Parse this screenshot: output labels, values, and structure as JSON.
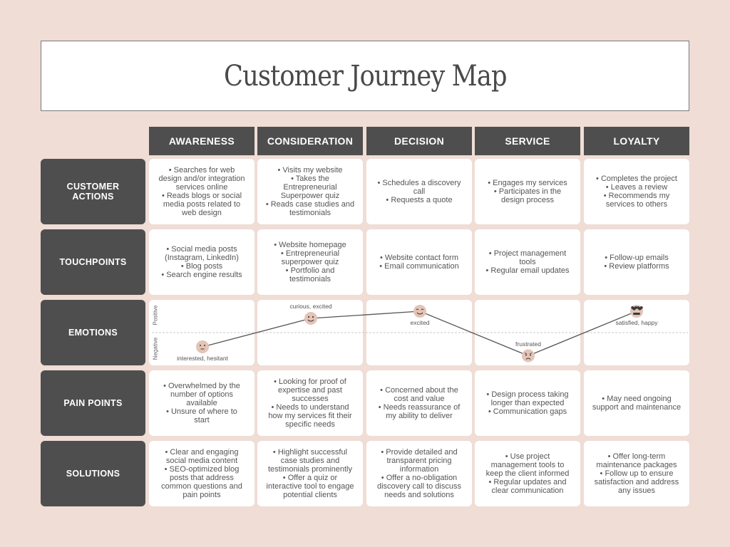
{
  "title": "Customer Journey Map",
  "stages": [
    "AWARENESS",
    "CONSIDERATION",
    "DECISION",
    "SERVICE",
    "LOYALTY"
  ],
  "rows": {
    "customer_actions": {
      "label": "CUSTOMER\nACTIONS",
      "cells": [
        "• Searches for web\ndesign and/or integration\nservices online\n• Reads blogs or social\nmedia posts related to\nweb design",
        "• Visits my website\n• Takes the\nEntrepreneurial\nSuperpower quiz\n• Reads case studies and\ntestimonials",
        "• Schedules a discovery\ncall\n• Requests a quote",
        "• Engages my services\n• Participates in the\ndesign process",
        "• Completes the project\n• Leaves a review\n• Recommends my\nservices to others"
      ]
    },
    "touchpoints": {
      "label": "TOUCHPOINTS",
      "cells": [
        "• Social media posts\n(Instagram, LinkedIn)\n• Blog posts\n• Search engine results",
        "• Website homepage\n• Entrepreneurial\nsuperpower quiz\n• Portfolio and\ntestimonials",
        "• Website contact form\n• Email communication",
        "• Project management\ntools\n• Regular email updates",
        "• Follow-up emails\n• Review platforms"
      ]
    },
    "emotions": {
      "label": "EMOTIONS",
      "axis_positive": "Positive",
      "axis_negative": "Negative",
      "points": [
        {
          "stage": "AWARENESS",
          "label": "interested, hesitant",
          "face": "hesitant-face-icon",
          "level": -0.4
        },
        {
          "stage": "CONSIDERATION",
          "label": "curious, excited",
          "face": "curious-face-icon",
          "level": 0.4
        },
        {
          "stage": "DECISION",
          "label": "excited",
          "face": "happy-face-icon",
          "level": 0.6
        },
        {
          "stage": "SERVICE",
          "label": "frustrated",
          "face": "frustrated-face-icon",
          "level": -0.65
        },
        {
          "stage": "LOYALTY",
          "label": "satisfied, happy",
          "face": "heart-eyes-face-icon",
          "level": 0.6
        }
      ]
    },
    "pain_points": {
      "label": "PAIN POINTS",
      "cells": [
        "• Overwhelmed by the\nnumber of options\navailable\n• Unsure of where to\nstart",
        "• Looking for proof of\nexpertise and past\nsuccesses\n• Needs to understand\nhow my services fit their\nspecific needs",
        "• Concerned about the\ncost and value\n• Needs reassurance of\nmy ability to deliver",
        "• Design process taking\nlonger than expected\n• Communication gaps",
        "• May need ongoing\nsupport and maintenance"
      ]
    },
    "solutions": {
      "label": "SOLUTIONS",
      "cells": [
        "• Clear and engaging\nsocial media content\n• SEO-optimized blog\nposts that address\ncommon questions and\npain points",
        "• Highlight successful\ncase studies and\ntestimonials prominently\n• Offer a quiz or\ninteractive tool to engage\npotential clients",
        "• Provide detailed and\ntransparent pricing\ninformation\n• Offer a no-obligation\ndiscovery call to discuss\nneeds and solutions",
        "• Use project\nmanagement tools to\nkeep the client informed\n• Regular updates and\nclear communication",
        "• Offer long-term\nmaintenance packages\n• Follow up to ensure\nsatisfaction and address\nany issues"
      ]
    }
  },
  "colors": {
    "background": "#efddd6",
    "header_dark": "#4e4e4e",
    "cell": "#ffffff",
    "face": "#e3c4b6",
    "line": "#555555"
  }
}
